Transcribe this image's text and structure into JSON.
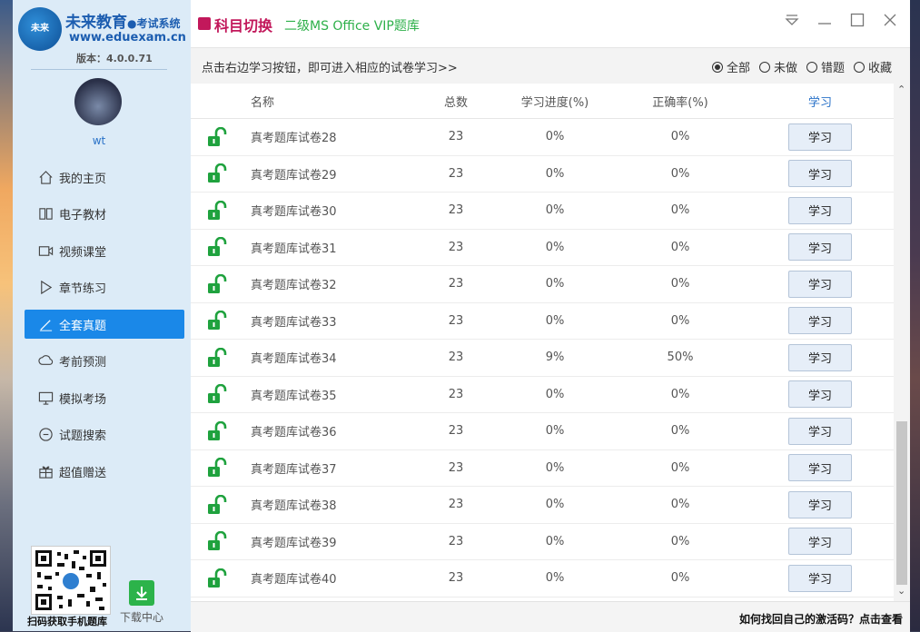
{
  "sidebar": {
    "brand_name": "未来教育",
    "brand_sub": "●考试系统",
    "brand_url": "www.eduexam.cn",
    "version": "版本：4.0.0.71",
    "username": "wt",
    "nav": [
      {
        "label": "我的主页",
        "icon": "home-icon"
      },
      {
        "label": "电子教材",
        "icon": "book-icon"
      },
      {
        "label": "视频课堂",
        "icon": "video-icon"
      },
      {
        "label": "章节练习",
        "icon": "play-icon"
      },
      {
        "label": "全套真题",
        "icon": "pencil-icon",
        "active": true
      },
      {
        "label": "考前预测",
        "icon": "cloud-icon"
      },
      {
        "label": "模拟考场",
        "icon": "monitor-icon"
      },
      {
        "label": "试题搜索",
        "icon": "search-icon"
      },
      {
        "label": "超值赠送",
        "icon": "gift-icon"
      }
    ],
    "qr_label": "扫码获取手机题库",
    "download_label": "下载中心"
  },
  "titlebar": {
    "switch_label": "科目切换",
    "subject": "二级MS Office  VIP题库"
  },
  "infobar": {
    "hint": "点击右边学习按钮，即可进入相应的试卷学习>>",
    "filters": [
      "全部",
      "未做",
      "错题",
      "收藏"
    ],
    "selected_filter": "全部"
  },
  "table": {
    "headers": {
      "name": "名称",
      "total": "总数",
      "progress": "学习进度(%)",
      "rate": "正确率(%)",
      "study": "学习"
    },
    "rows": [
      {
        "name": "真考题库试卷28",
        "total": "23",
        "progress": "0%",
        "rate": "0%",
        "btn": "学习"
      },
      {
        "name": "真考题库试卷29",
        "total": "23",
        "progress": "0%",
        "rate": "0%",
        "btn": "学习"
      },
      {
        "name": "真考题库试卷30",
        "total": "23",
        "progress": "0%",
        "rate": "0%",
        "btn": "学习"
      },
      {
        "name": "真考题库试卷31",
        "total": "23",
        "progress": "0%",
        "rate": "0%",
        "btn": "学习"
      },
      {
        "name": "真考题库试卷32",
        "total": "23",
        "progress": "0%",
        "rate": "0%",
        "btn": "学习"
      },
      {
        "name": "真考题库试卷33",
        "total": "23",
        "progress": "0%",
        "rate": "0%",
        "btn": "学习"
      },
      {
        "name": "真考题库试卷34",
        "total": "23",
        "progress": "9%",
        "rate": "50%",
        "btn": "学习"
      },
      {
        "name": "真考题库试卷35",
        "total": "23",
        "progress": "0%",
        "rate": "0%",
        "btn": "学习"
      },
      {
        "name": "真考题库试卷36",
        "total": "23",
        "progress": "0%",
        "rate": "0%",
        "btn": "学习"
      },
      {
        "name": "真考题库试卷37",
        "total": "23",
        "progress": "0%",
        "rate": "0%",
        "btn": "学习"
      },
      {
        "name": "真考题库试卷38",
        "total": "23",
        "progress": "0%",
        "rate": "0%",
        "btn": "学习"
      },
      {
        "name": "真考题库试卷39",
        "total": "23",
        "progress": "0%",
        "rate": "0%",
        "btn": "学习"
      },
      {
        "name": "真考题库试卷40",
        "total": "23",
        "progress": "0%",
        "rate": "0%",
        "btn": "学习"
      }
    ]
  },
  "footer": {
    "text": "如何找回自己的激活码？点击查看"
  },
  "colors": {
    "accent": "#1a88e8",
    "lock": "#1fa23e",
    "switch": "#c2185b",
    "subject": "#2eb04a"
  }
}
